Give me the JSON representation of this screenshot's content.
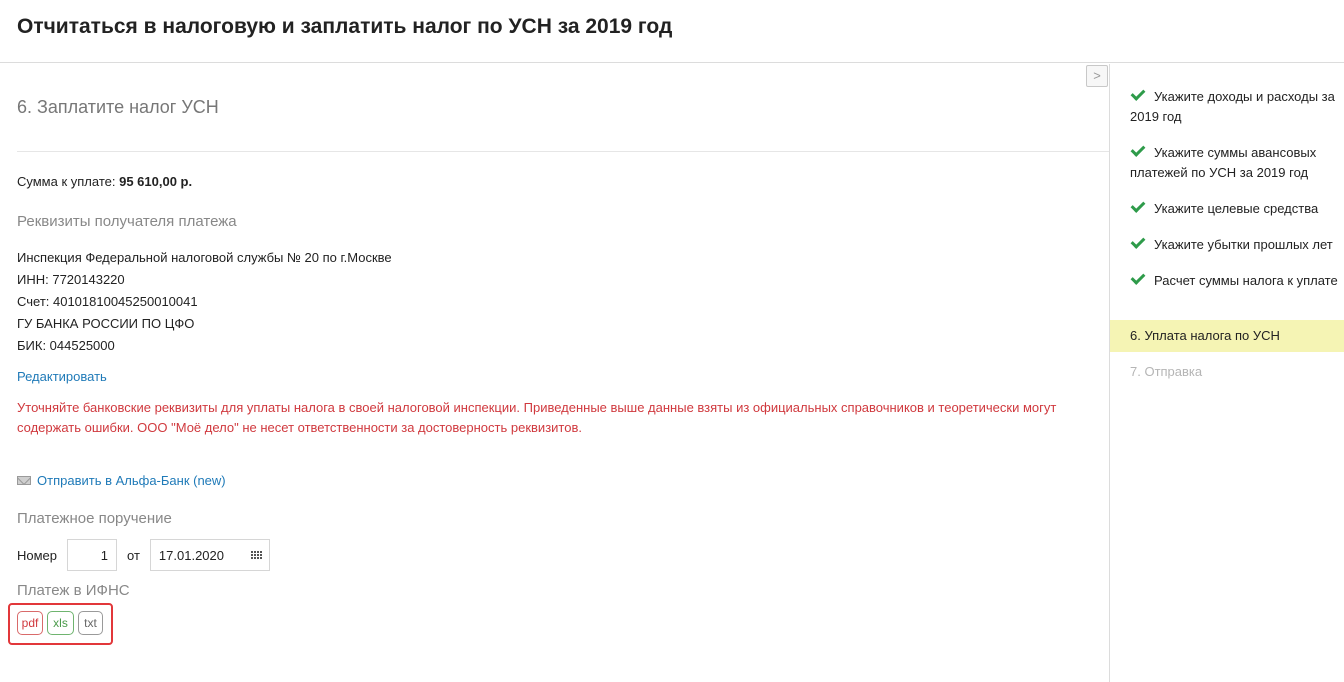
{
  "header": {
    "title": "Отчитаться в налоговую и заплатить налог по УСН за 2019 год"
  },
  "main": {
    "collapse_glyph": ">",
    "step_title": "6. Заплатите налог УСН",
    "amount_label": "Сумма к уплате:",
    "amount_value": "95 610,00 р.",
    "recipient_heading": "Реквизиты получателя платежа",
    "recipient_lines": [
      "Инспекция Федеральной налоговой службы № 20 по г.Москве",
      "ИНН: 7720143220",
      "Счет: 40101810045250010041",
      "ГУ БАНКА РОССИИ ПО ЦФО",
      "БИК: 044525000"
    ],
    "edit_link": "Редактировать",
    "warning": "Уточняйте банковские реквизиты для уплаты налога в своей налоговой инспекции. Приведенные выше данные взяты из официальных справочников и теоретически могут содержать ошибки. ООО \"Моё дело\" не несет ответственности за достоверность реквизитов.",
    "send_link": "Отправить в Альфа-Банк (new)",
    "payment_order_heading": "Платежное поручение",
    "number_label": "Номер",
    "number_value": "1",
    "from_label": "от",
    "date_value": "17.01.2020",
    "payment_ifns_heading": "Платеж в ИФНС",
    "formats": {
      "pdf": "pdf",
      "xls": "xls",
      "txt": "txt"
    }
  },
  "sidebar": {
    "items": [
      {
        "label": "Укажите доходы и расходы за 2019 год",
        "state": "done"
      },
      {
        "label": "Укажите суммы авансовых платежей по УСН за 2019 год",
        "state": "done"
      },
      {
        "label": "Укажите целевые средства",
        "state": "done"
      },
      {
        "label": "Укажите убытки прошлых лет",
        "state": "done"
      },
      {
        "label": "Расчет суммы налога к уплате",
        "state": "done"
      },
      {
        "label": "6.  Уплата налога по УСН",
        "state": "active"
      },
      {
        "label": "7.  Отправка",
        "state": "disabled"
      }
    ]
  },
  "colors": {
    "warning": "#d0393e",
    "link": "#1f7ab8",
    "active_step": "#f5f4b4",
    "check": "#2e9b4a",
    "highlight_box": "#e2373a"
  }
}
